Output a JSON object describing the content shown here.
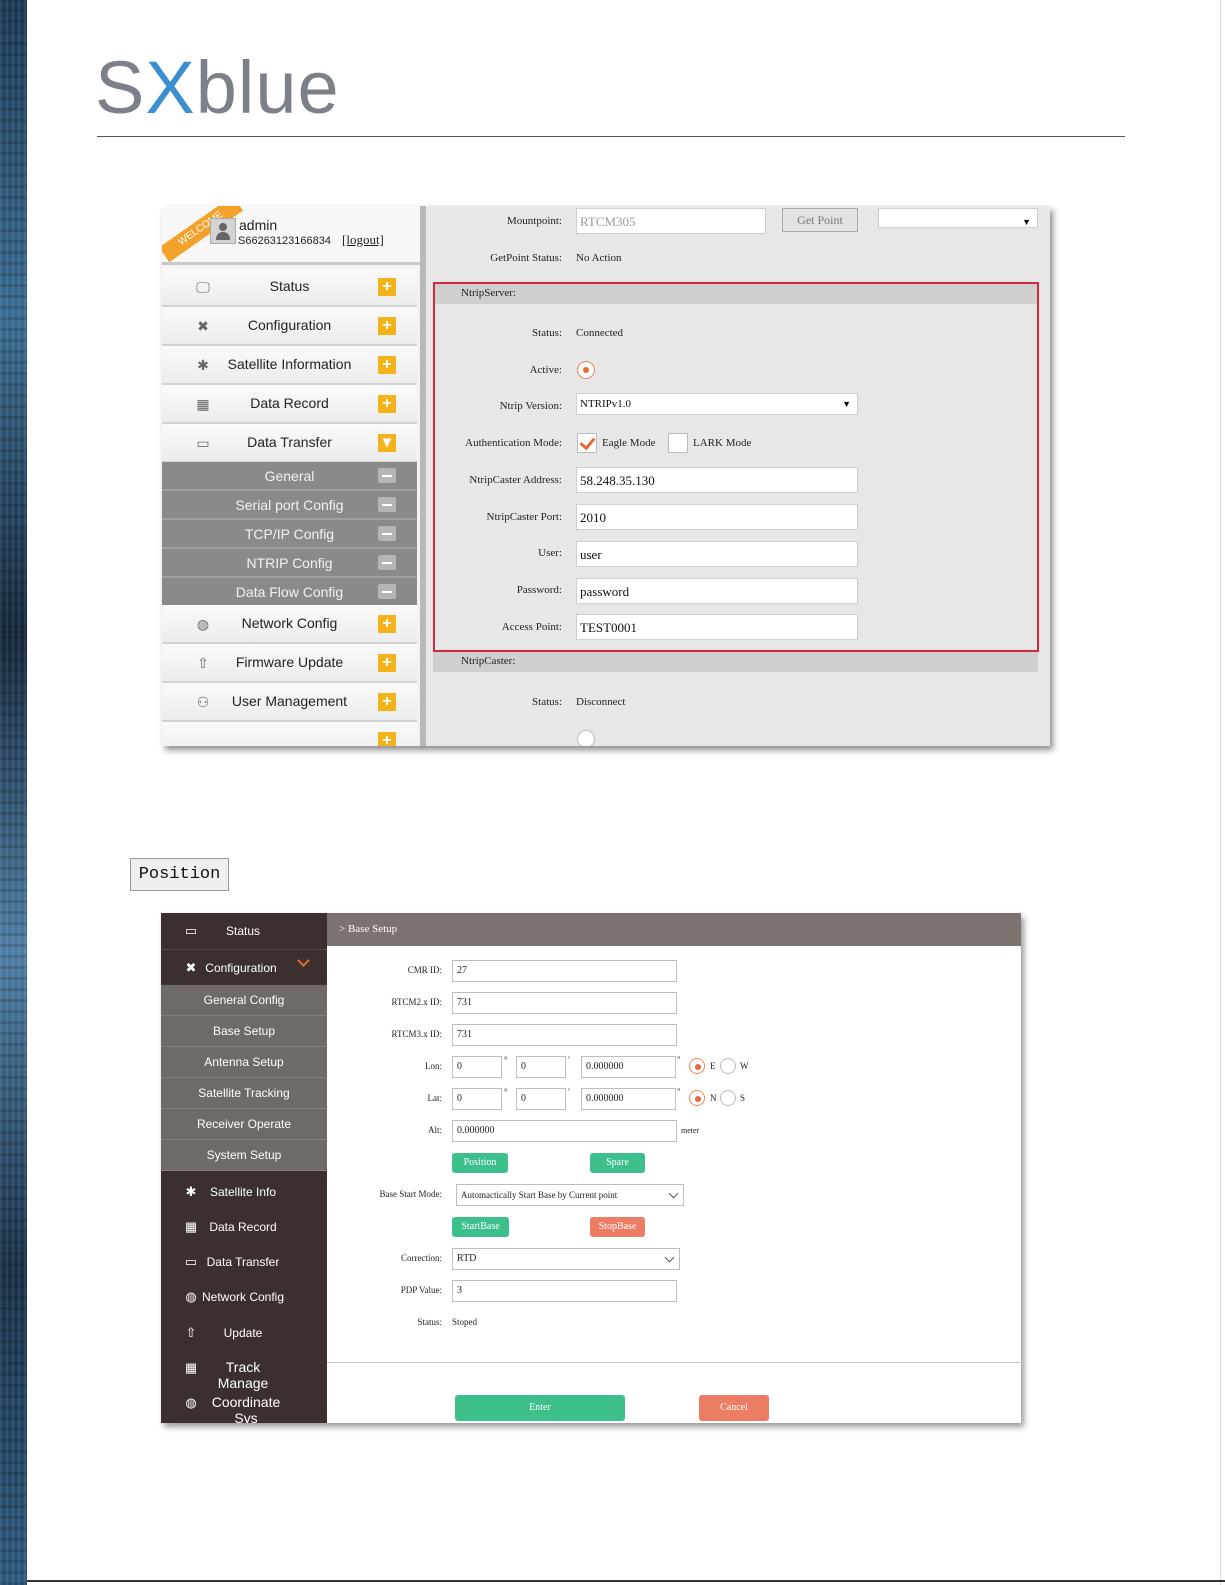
{
  "brand": {
    "logo_pre": "S",
    "logo_x": "X",
    "logo_post": "blue"
  },
  "shot1": {
    "welcome": "WELCOME",
    "user": {
      "name": "admin",
      "serial": "S66263123166834",
      "logout": "[logout]"
    },
    "menu": [
      {
        "label": "Status",
        "icon": "monitor-icon",
        "glyph": "🖵"
      },
      {
        "label": "Configuration",
        "icon": "tools-icon",
        "glyph": "✖"
      },
      {
        "label": "Satellite Information",
        "icon": "satellite-icon",
        "glyph": "✱"
      },
      {
        "label": "Data Record",
        "icon": "calendar-icon",
        "glyph": "▦"
      },
      {
        "label": "Data Transfer",
        "icon": "computer-icon",
        "glyph": "▭"
      }
    ],
    "submenu": [
      "General",
      "Serial port Config",
      "TCP/IP Config",
      "NTRIP Config",
      "Data Flow Config"
    ],
    "menu2": [
      {
        "label": "Network Config",
        "icon": "globe-icon",
        "glyph": "◍"
      },
      {
        "label": "Firmware Update",
        "icon": "upload-icon",
        "glyph": "⇧"
      },
      {
        "label": "User Management",
        "icon": "users-icon",
        "glyph": "⚇"
      }
    ],
    "form": {
      "mountpoint_label": "Mountpoint:",
      "mountpoint_value": "RTCM305",
      "get_point_button": "Get Point",
      "getpoint_status_label": "GetPoint Status:",
      "getpoint_status_value": "No Action",
      "ntripserver_header": "NtripServer:",
      "status_label": "Status:",
      "status_value": "Connected",
      "active_label": "Active:",
      "ntrip_version_label": "Ntrip Version:",
      "ntrip_version_value": "NTRIPv1.0",
      "auth_label": "Authentication Mode:",
      "auth_eagle": "Eagle Mode",
      "auth_lark": "LARK Mode",
      "caster_address_label": "NtripCaster Address:",
      "caster_address_value": "58.248.35.130",
      "caster_port_label": "NtripCaster Port:",
      "caster_port_value": "2010",
      "user_label": "User:",
      "user_value": "user",
      "password_label": "Password:",
      "password_value": "password",
      "access_point_label": "Access Point:",
      "access_point_value": "TEST0001",
      "ntripcaster_header": "NtripCaster:",
      "caster_status_label": "Status:",
      "caster_status_value": "Disconnect"
    }
  },
  "position_button": "Position",
  "shot2": {
    "sidebar": {
      "status": "Status",
      "configuration": "Configuration",
      "submenu": [
        "General Config",
        "Base Setup",
        "Antenna Setup",
        "Satellite Tracking",
        "Receiver Operate",
        "System Setup"
      ],
      "items": [
        {
          "label": "Satellite Info",
          "icon": "satellite-icon",
          "glyph": "✱"
        },
        {
          "label": "Data Record",
          "icon": "calendar-icon",
          "glyph": "▦"
        },
        {
          "label": "Data Transfer",
          "icon": "computer-icon",
          "glyph": "▭"
        },
        {
          "label": "Network Config",
          "icon": "globe-icon",
          "glyph": "◍"
        },
        {
          "label": "Update",
          "icon": "upload-icon",
          "glyph": "⇧"
        },
        {
          "label": "Track Manage",
          "icon": "calendar-icon",
          "glyph": "▦"
        },
        {
          "label": "Coordinate Sys",
          "icon": "globe-icon",
          "glyph": "◍"
        }
      ]
    },
    "header": "> Base Setup",
    "form": {
      "cmr_label": "CMR ID:",
      "cmr_value": "27",
      "rtcm2_label": "RTCM2.x ID:",
      "rtcm2_value": "731",
      "rtcm3_label": "RTCM3.x ID:",
      "rtcm3_value": "731",
      "lon_label": "Lon:",
      "lon_deg": "0",
      "lon_min": "0",
      "lon_sec": "0.000000",
      "lat_label": "Lat:",
      "lat_deg": "0",
      "lat_min": "0",
      "lat_sec": "0.000000",
      "deg_sym": "°",
      "min_sym": "′",
      "sec_sym": "″",
      "east": "E",
      "west": "W",
      "north": "N",
      "south": "S",
      "alt_label": "Alt:",
      "alt_value": "0.000000",
      "alt_unit": "meter",
      "position_button": "Position",
      "spare_button": "Spare",
      "start_mode_label": "Base Start Mode:",
      "start_mode_value": "Automactically Start Base by Current point",
      "start_base_button": "StartBase",
      "stop_base_button": "StopBase",
      "correction_label": "Correction:",
      "correction_value": "RTD",
      "pdop_label": "PDP Value:",
      "pdop_value": "3",
      "status_label": "Status:",
      "status_value": "Stoped",
      "enter_button": "Enter",
      "cancel_button": "Cancel"
    }
  }
}
